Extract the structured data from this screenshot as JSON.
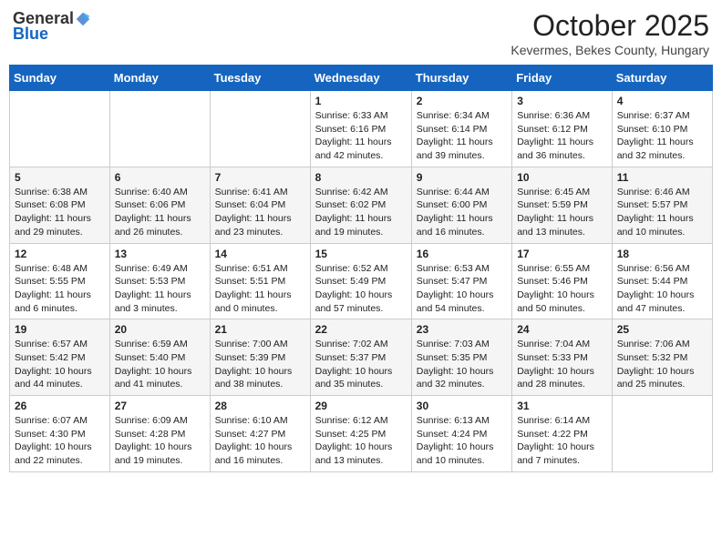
{
  "header": {
    "logo_general": "General",
    "logo_blue": "Blue",
    "month": "October 2025",
    "location": "Kevermes, Bekes County, Hungary"
  },
  "weekdays": [
    "Sunday",
    "Monday",
    "Tuesday",
    "Wednesday",
    "Thursday",
    "Friday",
    "Saturday"
  ],
  "weeks": [
    [
      {
        "day": "",
        "info": ""
      },
      {
        "day": "",
        "info": ""
      },
      {
        "day": "",
        "info": ""
      },
      {
        "day": "1",
        "info": "Sunrise: 6:33 AM\nSunset: 6:16 PM\nDaylight: 11 hours\nand 42 minutes."
      },
      {
        "day": "2",
        "info": "Sunrise: 6:34 AM\nSunset: 6:14 PM\nDaylight: 11 hours\nand 39 minutes."
      },
      {
        "day": "3",
        "info": "Sunrise: 6:36 AM\nSunset: 6:12 PM\nDaylight: 11 hours\nand 36 minutes."
      },
      {
        "day": "4",
        "info": "Sunrise: 6:37 AM\nSunset: 6:10 PM\nDaylight: 11 hours\nand 32 minutes."
      }
    ],
    [
      {
        "day": "5",
        "info": "Sunrise: 6:38 AM\nSunset: 6:08 PM\nDaylight: 11 hours\nand 29 minutes."
      },
      {
        "day": "6",
        "info": "Sunrise: 6:40 AM\nSunset: 6:06 PM\nDaylight: 11 hours\nand 26 minutes."
      },
      {
        "day": "7",
        "info": "Sunrise: 6:41 AM\nSunset: 6:04 PM\nDaylight: 11 hours\nand 23 minutes."
      },
      {
        "day": "8",
        "info": "Sunrise: 6:42 AM\nSunset: 6:02 PM\nDaylight: 11 hours\nand 19 minutes."
      },
      {
        "day": "9",
        "info": "Sunrise: 6:44 AM\nSunset: 6:00 PM\nDaylight: 11 hours\nand 16 minutes."
      },
      {
        "day": "10",
        "info": "Sunrise: 6:45 AM\nSunset: 5:59 PM\nDaylight: 11 hours\nand 13 minutes."
      },
      {
        "day": "11",
        "info": "Sunrise: 6:46 AM\nSunset: 5:57 PM\nDaylight: 11 hours\nand 10 minutes."
      }
    ],
    [
      {
        "day": "12",
        "info": "Sunrise: 6:48 AM\nSunset: 5:55 PM\nDaylight: 11 hours\nand 6 minutes."
      },
      {
        "day": "13",
        "info": "Sunrise: 6:49 AM\nSunset: 5:53 PM\nDaylight: 11 hours\nand 3 minutes."
      },
      {
        "day": "14",
        "info": "Sunrise: 6:51 AM\nSunset: 5:51 PM\nDaylight: 11 hours\nand 0 minutes."
      },
      {
        "day": "15",
        "info": "Sunrise: 6:52 AM\nSunset: 5:49 PM\nDaylight: 10 hours\nand 57 minutes."
      },
      {
        "day": "16",
        "info": "Sunrise: 6:53 AM\nSunset: 5:47 PM\nDaylight: 10 hours\nand 54 minutes."
      },
      {
        "day": "17",
        "info": "Sunrise: 6:55 AM\nSunset: 5:46 PM\nDaylight: 10 hours\nand 50 minutes."
      },
      {
        "day": "18",
        "info": "Sunrise: 6:56 AM\nSunset: 5:44 PM\nDaylight: 10 hours\nand 47 minutes."
      }
    ],
    [
      {
        "day": "19",
        "info": "Sunrise: 6:57 AM\nSunset: 5:42 PM\nDaylight: 10 hours\nand 44 minutes."
      },
      {
        "day": "20",
        "info": "Sunrise: 6:59 AM\nSunset: 5:40 PM\nDaylight: 10 hours\nand 41 minutes."
      },
      {
        "day": "21",
        "info": "Sunrise: 7:00 AM\nSunset: 5:39 PM\nDaylight: 10 hours\nand 38 minutes."
      },
      {
        "day": "22",
        "info": "Sunrise: 7:02 AM\nSunset: 5:37 PM\nDaylight: 10 hours\nand 35 minutes."
      },
      {
        "day": "23",
        "info": "Sunrise: 7:03 AM\nSunset: 5:35 PM\nDaylight: 10 hours\nand 32 minutes."
      },
      {
        "day": "24",
        "info": "Sunrise: 7:04 AM\nSunset: 5:33 PM\nDaylight: 10 hours\nand 28 minutes."
      },
      {
        "day": "25",
        "info": "Sunrise: 7:06 AM\nSunset: 5:32 PM\nDaylight: 10 hours\nand 25 minutes."
      }
    ],
    [
      {
        "day": "26",
        "info": "Sunrise: 6:07 AM\nSunset: 4:30 PM\nDaylight: 10 hours\nand 22 minutes."
      },
      {
        "day": "27",
        "info": "Sunrise: 6:09 AM\nSunset: 4:28 PM\nDaylight: 10 hours\nand 19 minutes."
      },
      {
        "day": "28",
        "info": "Sunrise: 6:10 AM\nSunset: 4:27 PM\nDaylight: 10 hours\nand 16 minutes."
      },
      {
        "day": "29",
        "info": "Sunrise: 6:12 AM\nSunset: 4:25 PM\nDaylight: 10 hours\nand 13 minutes."
      },
      {
        "day": "30",
        "info": "Sunrise: 6:13 AM\nSunset: 4:24 PM\nDaylight: 10 hours\nand 10 minutes."
      },
      {
        "day": "31",
        "info": "Sunrise: 6:14 AM\nSunset: 4:22 PM\nDaylight: 10 hours\nand 7 minutes."
      },
      {
        "day": "",
        "info": ""
      }
    ]
  ]
}
